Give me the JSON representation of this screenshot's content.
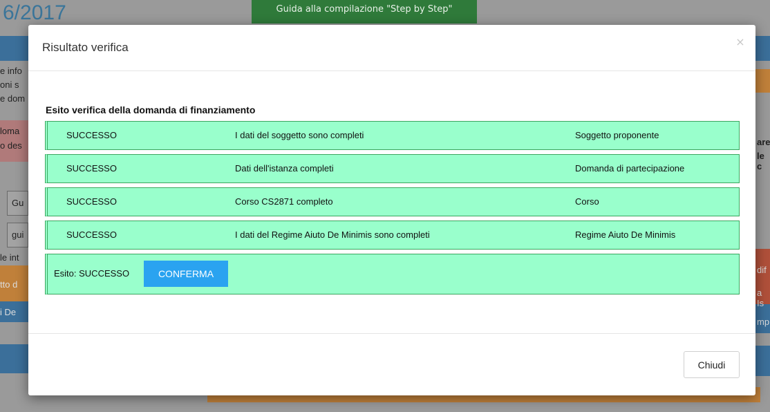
{
  "background": {
    "title_fragment": "6/2017",
    "guide_button": "Guida alla compilazione \"Step by Step\"",
    "left_fragments": [
      "e info",
      "oni s",
      "e dom",
      "loma",
      "o des",
      "Gu",
      "gui",
      "le int",
      "tto d",
      "i De"
    ],
    "right_fragments": [
      "are",
      "le c",
      "dif",
      "a Is",
      "mp"
    ]
  },
  "modal": {
    "title": "Risultato verifica",
    "close_glyph": "×",
    "heading": "Esito verifica della domanda di finanziamento",
    "rows": [
      {
        "status": "SUCCESSO",
        "message": "I dati del soggetto sono completi",
        "section": "Soggetto proponente"
      },
      {
        "status": "SUCCESSO",
        "message": "Dati dell'istanza completi",
        "section": "Domanda di partecipazione"
      },
      {
        "status": "SUCCESSO",
        "message": "Corso CS2871 completo",
        "section": "Corso"
      },
      {
        "status": "SUCCESSO",
        "message": "I dati del Regime Aiuto De Minimis sono completi",
        "section": "Regime Aiuto De Minimis"
      }
    ],
    "final_label": "Esito: SUCCESSO",
    "confirm_label": "CONFERMA",
    "footer_close_label": "Chiudi"
  },
  "colors": {
    "success_row_bg": "#99ffcc",
    "success_row_border": "#3aa65e",
    "confirm_button_bg": "#2aa3f0",
    "guide_button_bg": "#2f7a3a",
    "overlay": "#9a9a9a"
  }
}
